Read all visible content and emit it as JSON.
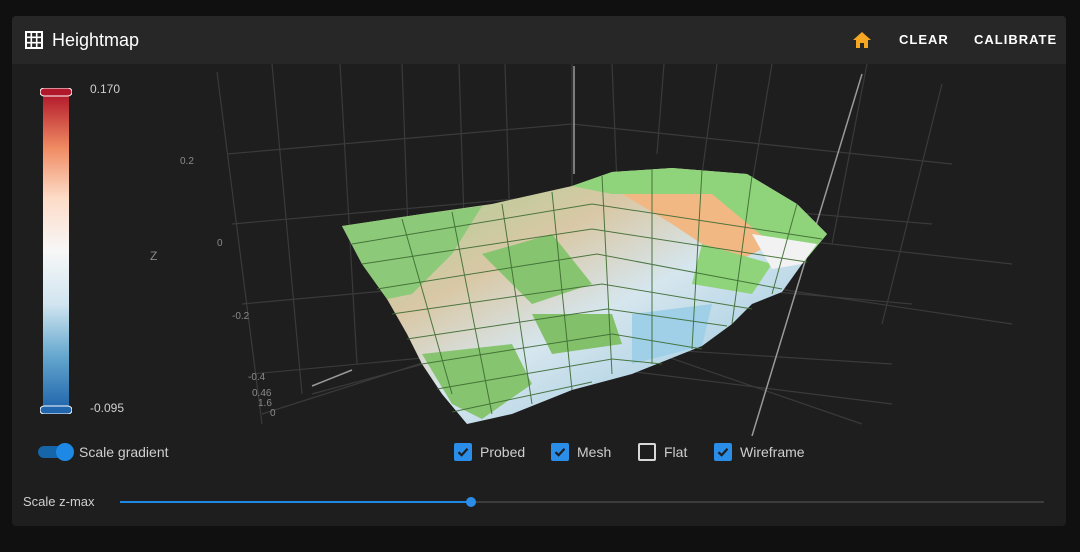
{
  "header": {
    "title": "Heightmap",
    "icon": "grid-icon",
    "home_icon": "home-icon",
    "clear_label": "CLEAR",
    "calibrate_label": "CALIBRATE",
    "accent_color": "#f5a623"
  },
  "plot": {
    "z_axis_label": "Z",
    "z_ticks": [
      "0.2",
      "0",
      "-0.2",
      "-0.4"
    ],
    "x_ticks": [
      "0.46",
      "1.6",
      "0"
    ]
  },
  "colorbar": {
    "max": "0.170",
    "min": "-0.095",
    "colors": [
      "#b2182b",
      "#ef8a62",
      "#fddbc7",
      "#f7f7f7",
      "#d1e5f0",
      "#67a9cf",
      "#2166ac"
    ]
  },
  "controls": {
    "scale_gradient": {
      "label": "Scale gradient",
      "on": true
    },
    "checkboxes": [
      {
        "label": "Probed",
        "checked": true
      },
      {
        "label": "Mesh",
        "checked": true
      },
      {
        "label": "Flat",
        "checked": false
      },
      {
        "label": "Wireframe",
        "checked": true
      }
    ],
    "slider": {
      "label": "Scale z-max",
      "value": 0.38
    }
  }
}
